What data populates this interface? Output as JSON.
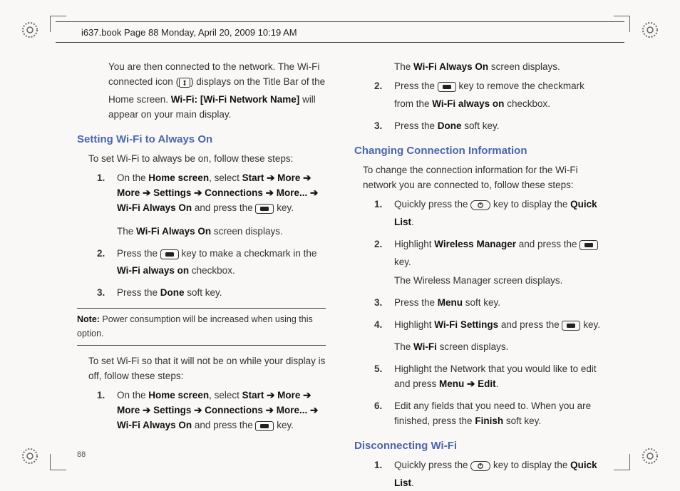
{
  "header": {
    "running": "i637.book  Page 88  Monday, April 20, 2009  10:19 AM"
  },
  "page_number": "88",
  "left": {
    "intro_p1_a": "You are then connected to the network. The Wi-Fi connected icon (",
    "intro_p1_b": ") displays on the Title Bar of the Home screen. ",
    "intro_p1_bold": "Wi-Fi: [Wi-Fi Network Name]",
    "intro_p1_c": " will appear on your main display.",
    "sec1_title": "Setting Wi-Fi to Always On",
    "sec1_lead": "To set Wi-Fi to always be on, follow these steps:",
    "sec1_s1_a": "On the ",
    "sec1_s1_b": "Home screen",
    "sec1_s1_c": ", select ",
    "sec1_s1_d": "Start ➔ More ➔ More ➔ Settings ➔ Connections ➔ More... ➔ Wi-Fi Always On",
    "sec1_s1_e": " and press the ",
    "sec1_s1_f": " key.",
    "sec1_s1_g": "The ",
    "sec1_s1_h": "Wi-Fi Always On",
    "sec1_s1_i": " screen displays.",
    "sec1_s2_a": "Press the ",
    "sec1_s2_b": " key to make a checkmark in the ",
    "sec1_s2_c": "Wi-Fi always on",
    "sec1_s2_d": " checkbox.",
    "sec1_s3_a": "Press the ",
    "sec1_s3_b": "Done",
    "sec1_s3_c": " soft key.",
    "note_label": "Note:",
    "note_text": " Power consumption will be increased when using this option.",
    "sec2_lead": "To set Wi-Fi so that it will not be on while your display is off, follow these steps:",
    "sec2_s1_a": "On the ",
    "sec2_s1_b": "Home screen",
    "sec2_s1_c": ", select ",
    "sec2_s1_d": "Start ➔ More ➔ More ➔ Settings ➔ Connections ➔ More... ➔ Wi-Fi Always On",
    "sec2_s1_e": " and press the ",
    "sec2_s1_f": " key."
  },
  "right": {
    "top_a": "The ",
    "top_b": "Wi-Fi Always On",
    "top_c": " screen displays.",
    "s2_a": "Press the ",
    "s2_b": " key to remove the checkmark from the ",
    "s2_c": "Wi-Fi always on",
    "s2_d": " checkbox.",
    "s3_a": "Press the ",
    "s3_b": "Done",
    "s3_c": " soft key.",
    "sec2_title": "Changing Connection Information",
    "sec2_lead": "To change the connection information for the Wi-Fi network you are connected to, follow these steps:",
    "c1_a": "Quickly press the ",
    "c1_b": " key to display the ",
    "c1_c": "Quick List",
    "c1_d": ".",
    "c2_a": "Highlight ",
    "c2_b": "Wireless Manager",
    "c2_c": " and press the ",
    "c2_d": " key.",
    "c2_e": "The Wireless Manager screen displays.",
    "c3_a": "Press the ",
    "c3_b": "Menu",
    "c3_c": " soft key.",
    "c4_a": "Highlight ",
    "c4_b": "Wi-Fi Settings",
    "c4_c": " and press the ",
    "c4_d": " key.",
    "c4_e": "The ",
    "c4_f": "Wi-Fi",
    "c4_g": " screen displays.",
    "c5_a": "Highlight the Network that you would like to edit and press ",
    "c5_b": "Menu ➔ Edit",
    "c5_c": ".",
    "c6_a": "Edit any fields that you need to. When you are finished, press the ",
    "c6_b": "Finish",
    "c6_c": " soft key.",
    "sec3_title": "Disconnecting Wi-Fi",
    "d1_a": "Quickly press the ",
    "d1_b": " key to display the ",
    "d1_c": "Quick List",
    "d1_d": "."
  }
}
